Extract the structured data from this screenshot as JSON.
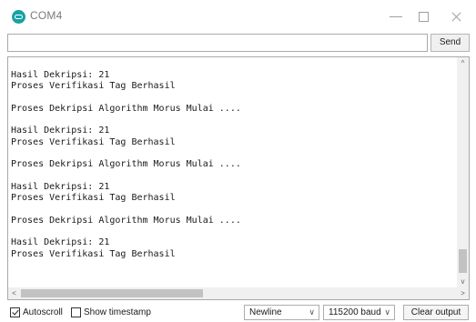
{
  "window": {
    "title": "COM4",
    "icon": "arduino-icon",
    "minimize_glyph": "—",
    "close_icon": "close-icon"
  },
  "input": {
    "value": "",
    "placeholder": "",
    "send_label": "Send"
  },
  "output": {
    "lines": [
      "Hasil Dekripsi: 21",
      "Proses Verifikasi Tag Berhasil",
      "",
      "Proses Dekripsi Algorithm Morus Mulai ....",
      "",
      "Hasil Dekripsi: 21",
      "Proses Verifikasi Tag Berhasil",
      "",
      "Proses Dekripsi Algorithm Morus Mulai ....",
      "",
      "Hasil Dekripsi: 21",
      "Proses Verifikasi Tag Berhasil",
      "",
      "Proses Dekripsi Algorithm Morus Mulai ....",
      "",
      "Hasil Dekripsi: 21",
      "Proses Verifikasi Tag Berhasil"
    ]
  },
  "scroll": {
    "up_glyph": "^",
    "down_glyph": "v",
    "left_glyph": "<",
    "right_glyph": ">"
  },
  "footer": {
    "autoscroll_label": "Autoscroll",
    "autoscroll_checked": true,
    "timestamp_label": "Show timestamp",
    "timestamp_checked": false,
    "line_ending": "Newline",
    "baud_rate": "115200 baud",
    "dropdown_glyph": "∨",
    "clear_label": "Clear output"
  },
  "colors": {
    "accent": "#17a1a5"
  }
}
